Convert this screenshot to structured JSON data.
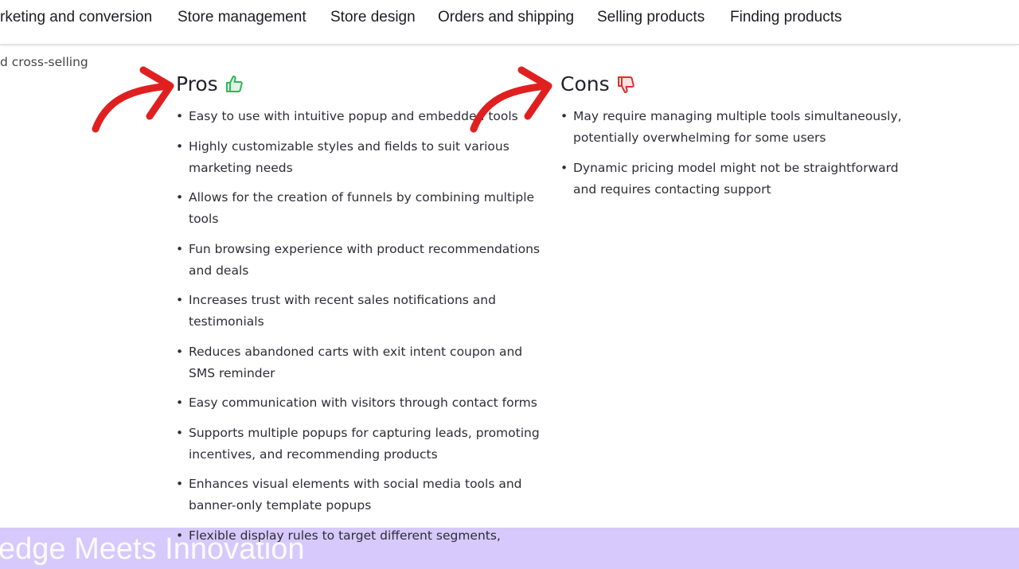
{
  "nav": {
    "items": [
      "rketing and conversion",
      "Store management",
      "Store design",
      "Orders and shipping",
      "Selling products",
      "Finding products"
    ]
  },
  "breadcrumb": "d cross-selling",
  "pros": {
    "title": "Pros",
    "icon": "thumbs-up-icon",
    "icon_color": "#2fb45a",
    "items": [
      "Easy to use with intuitive popup and embedded tools",
      "Highly customizable styles and fields to suit various marketing needs",
      "Allows for the creation of funnels by combining multiple tools",
      "Fun browsing experience with product recommendations and deals",
      "Increases trust with recent sales notifications and testimonials",
      "Reduces abandoned carts with exit intent coupon and SMS reminder",
      "Easy communication with visitors through contact forms",
      "Supports multiple popups for capturing leads, promoting incentives, and recommending products",
      "Enhances visual elements with social media tools and banner-only template popups",
      "Flexible display rules to target different segments,"
    ]
  },
  "cons": {
    "title": "Cons",
    "icon": "thumbs-down-icon",
    "icon_color": "#d9322e",
    "items": [
      "May require managing multiple tools simultaneously, potentially overwhelming for some users",
      "Dynamic pricing model might not be straightforward and requires contacting support"
    ]
  },
  "overlay_banner": "edge Meets Innovation",
  "annotation_color": "#e02020"
}
